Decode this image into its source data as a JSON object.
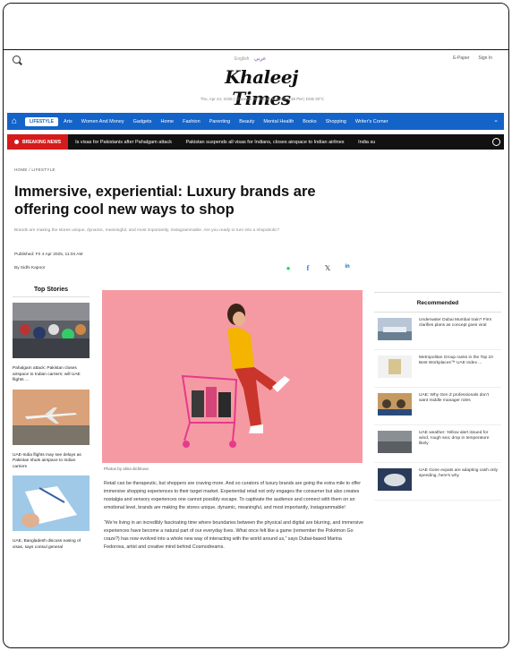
{
  "masthead": {
    "lang_en": "English",
    "lang_ar": "عربي",
    "logo": "Khaleej Times",
    "dateline": "Thu, Apr 24, 2025 | Shawwal 26, 1446 | Maghrib 6:48 PM | DXB 30°C",
    "epaper": "E-Paper",
    "sign_in": "Sign In"
  },
  "nav": {
    "active": "LIFESTYLE",
    "items": [
      "Arts",
      "Women And Money",
      "Gadgets",
      "Home",
      "Fashion",
      "Parenting",
      "Beauty",
      "Mental Health",
      "Books",
      "Shopping",
      "Writer's Corner"
    ]
  },
  "breaking": {
    "label": "BREAKING NEWS",
    "items": [
      "Is visas for Pakistanis after Pahalgam attack",
      "Pakistan suspends all visas for Indians, closes airspace to Indian airlines",
      "India su"
    ]
  },
  "article": {
    "breadcrumb": "HOME / LIFESTYLE",
    "headline": "Immersive, experiential: Luxury brands are offering cool new ways to shop",
    "summary": "Brands are making the stores unique, dynamic, meaningful, and most importantly, Instagrammable. Are you ready to turn into a shopaholic?",
    "published": "Published: Fri 4 Apr 2025, 11:04 AM",
    "author": "By Sidhi Kapoor",
    "caption": "Photos by alina dichkova",
    "paragraphs": [
      "Retail can be therapeutic, but shoppers are craving more. And so curators of luxury brands are going the extra mile to offer immersive shopping experiences to their target market. Experiential retail not only engages the consumer but also creates nostalgia and sensory experiences one cannot possibly escape. To captivate the audience and connect with them on an emotional level, brands are making the stores unique, dynamic, meaningful, and most importantly, Instagrammable!",
      "“We’re living in an incredibly fascinating time where boundaries between the physical and digital are blurring, and immersive experiences have become a natural part of our everyday lives. What once felt like a game (remember the Pokémon Go craze?) has now evolved into a whole new way of interacting with the world around us,” says Dubai-based Marina Fedorova, artist and creative mind behind Cosmodreams."
    ]
  },
  "top_stories": {
    "title": "Top Stories",
    "items": [
      {
        "text": "Pahalgam attack: Pakistan closes airspace to Indian carriers; will UAE flights ..."
      },
      {
        "text": "UAE-India flights may see delays as Pakistan shuts airspace to Indian carriers"
      },
      {
        "text": "UAE, Bangladesh discuss easing of visas, says consul general"
      }
    ]
  },
  "recommended": {
    "title": "Recommended",
    "items": [
      {
        "text": "Underwater Dubai Mumbai train? Firm clarifies plans as concept goes viral"
      },
      {
        "text": "Metropolitan Group ranks in the Top 10 Best Workplaces™ UAE Index ..."
      },
      {
        "text": "UAE: Why Gen Z professionals don't want middle manager roles"
      },
      {
        "text": "UAE weather: Yellow alert issued for wind, rough sea; drop in temperature likely"
      },
      {
        "text": "UAE Gone expats are adapting cash only spending, here's why"
      }
    ]
  },
  "colors": {
    "nav_blue": "#1463c9",
    "breaking_red": "#d51b1b",
    "hero_pink": "#f59aa3"
  }
}
